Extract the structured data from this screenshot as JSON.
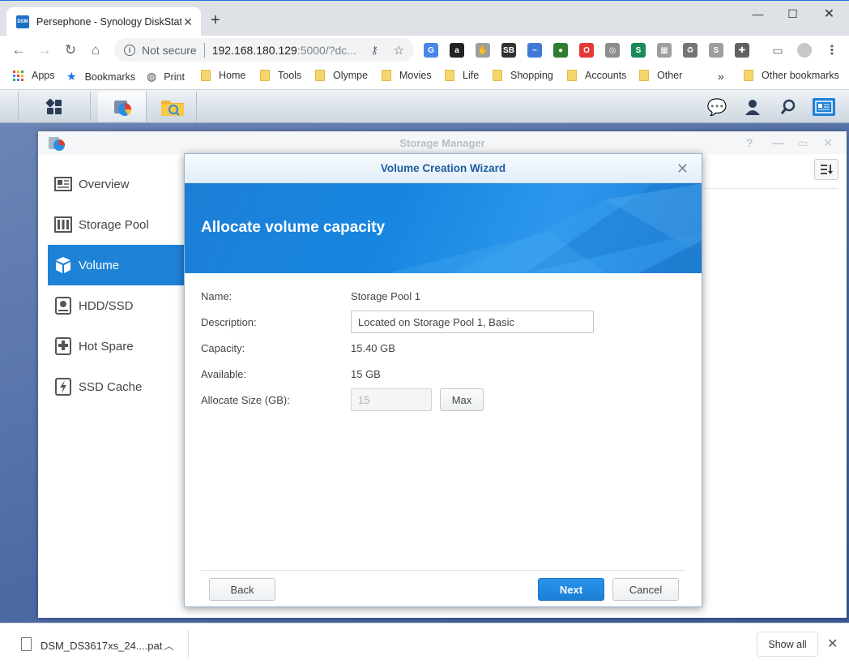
{
  "browser": {
    "tab_title": "Persephone - Synology DiskStation",
    "tab_favicon_text": "DSM",
    "address": {
      "security_label": "Not secure",
      "host": "192.168.180.129",
      "rest": ":5000/?dc..."
    },
    "extensions": [
      {
        "name": "google-translate-icon",
        "color": "#4a86e8",
        "glyph": "G"
      },
      {
        "name": "amazon-icon",
        "color": "#222222",
        "glyph": "a"
      },
      {
        "name": "hand-icon",
        "color": "#9e9e9e",
        "glyph": "✋"
      },
      {
        "name": "sb-icon",
        "color": "#333333",
        "glyph": "SB"
      },
      {
        "name": "pulse-icon",
        "color": "#3f7bd6",
        "glyph": "~"
      },
      {
        "name": "globe-lock-icon",
        "color": "#2e7d32",
        "glyph": "●"
      },
      {
        "name": "opera-icon",
        "color": "#e53935",
        "glyph": "O"
      },
      {
        "name": "magnifier-icon",
        "color": "#8d8d8d",
        "glyph": "◎"
      },
      {
        "name": "s-logo-icon",
        "color": "#1b8a5a",
        "glyph": "S"
      },
      {
        "name": "reader-icon",
        "color": "#9e9e9e",
        "glyph": "▦"
      },
      {
        "name": "recycle-icon",
        "color": "#757575",
        "glyph": "♻"
      },
      {
        "name": "skype-icon",
        "color": "#9e9e9e",
        "glyph": "S"
      },
      {
        "name": "puzzle-icon",
        "color": "#616161",
        "glyph": "✚"
      }
    ],
    "bookmarks": {
      "apps": "Apps",
      "items": [
        "Bookmarks",
        "Print",
        "Home",
        "Tools",
        "Olympe",
        "Movies",
        "Life",
        "Shopping",
        "Accounts",
        "Other"
      ],
      "overflow": "»",
      "other": "Other bookmarks"
    }
  },
  "storage_manager": {
    "title": "Storage Manager",
    "sidebar": [
      {
        "label": "Overview",
        "icon": "overview-icon",
        "active": false
      },
      {
        "label": "Storage Pool",
        "icon": "storage-pool-icon",
        "active": false
      },
      {
        "label": "Volume",
        "icon": "volume-icon",
        "active": true
      },
      {
        "label": "HDD/SSD",
        "icon": "hdd-icon",
        "active": false
      },
      {
        "label": "Hot Spare",
        "icon": "hot-spare-icon",
        "active": false
      },
      {
        "label": "SSD Cache",
        "icon": "ssd-cache-icon",
        "active": false
      }
    ]
  },
  "wizard": {
    "title": "Volume Creation Wizard",
    "heading": "Allocate volume capacity",
    "fields": {
      "name_label": "Name:",
      "name_value": "Storage Pool 1",
      "description_label": "Description:",
      "description_value": "Located on Storage Pool 1, Basic",
      "capacity_label": "Capacity:",
      "capacity_value": "15.40 GB",
      "available_label": "Available:",
      "available_value": "15 GB",
      "allocate_label": "Allocate Size (GB):",
      "allocate_value": "15",
      "max_button": "Max"
    },
    "buttons": {
      "back": "Back",
      "next": "Next",
      "cancel": "Cancel"
    }
  },
  "downloads": {
    "file_name": "DSM_DS3617xs_24....pat",
    "show_all": "Show all"
  }
}
